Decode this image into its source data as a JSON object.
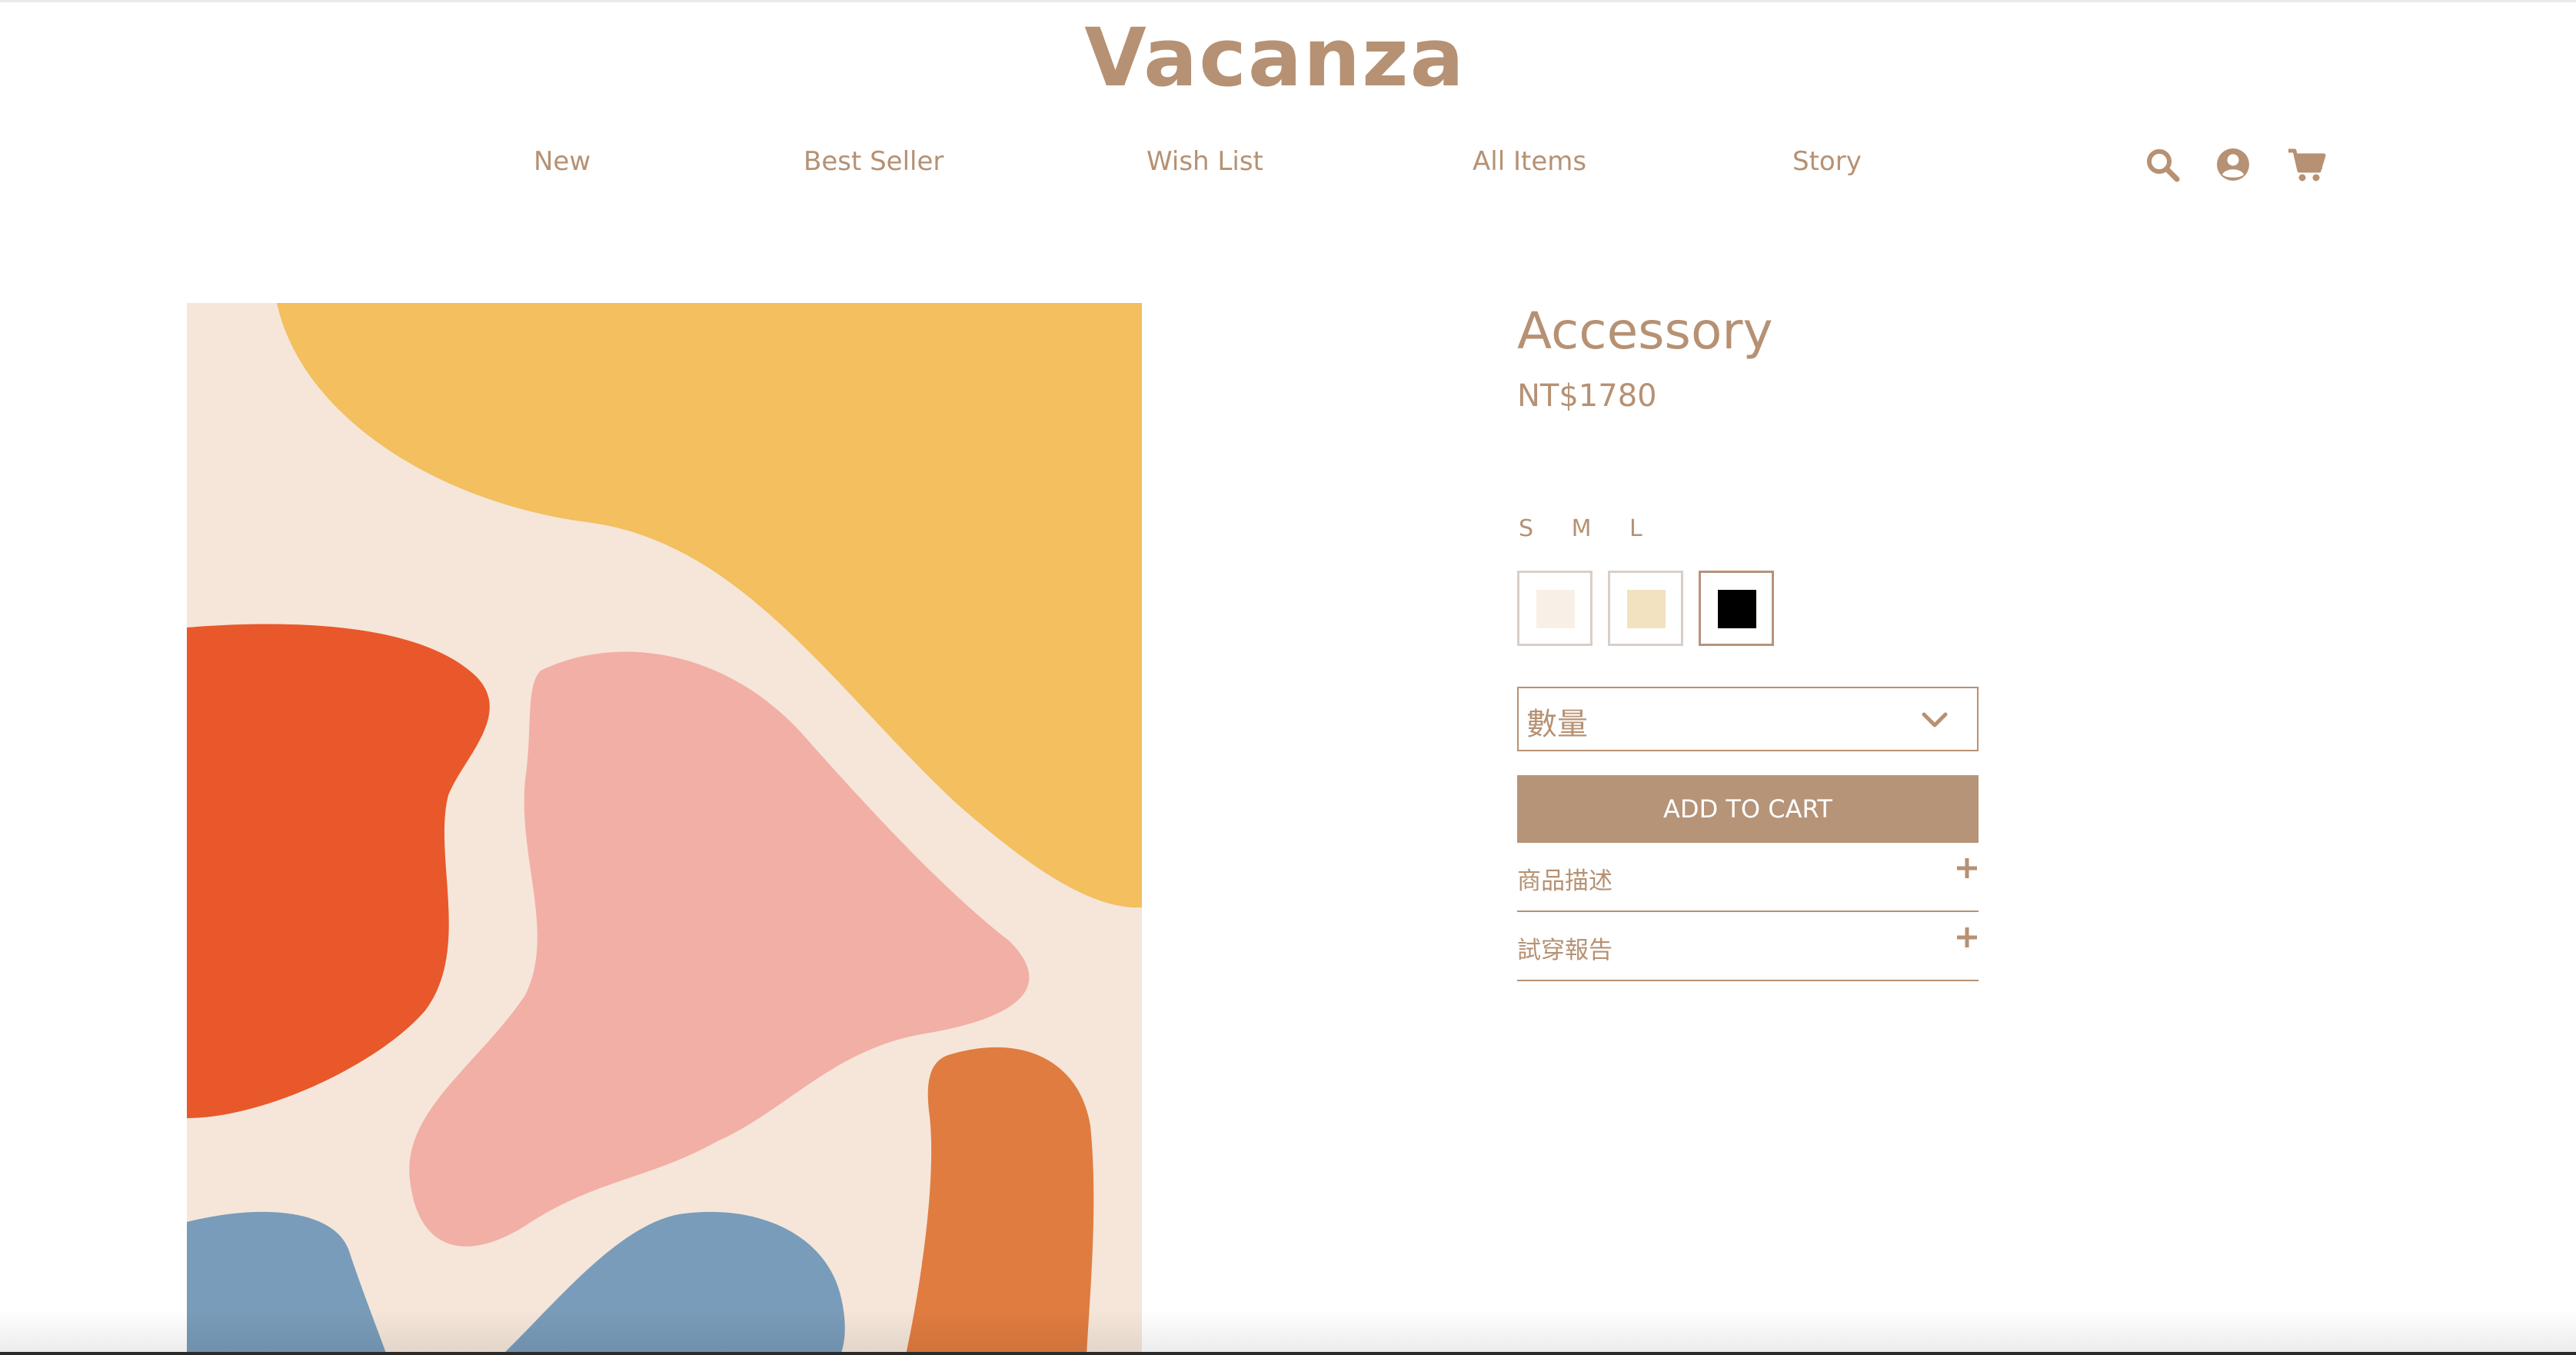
{
  "brand": {
    "logo": "Vacanza",
    "color": "#b69173"
  },
  "nav": {
    "items": [
      "New",
      "Best Seller",
      "Wish List",
      "All Items",
      "Story"
    ],
    "icons": [
      "search-icon",
      "user-icon",
      "cart-icon"
    ]
  },
  "product": {
    "title": "Accessory",
    "price": "NT$1780",
    "sizes_label": "S M L",
    "colors": [
      {
        "name": "cream",
        "hex": "#f8f0e6",
        "selected": false
      },
      {
        "name": "beige",
        "hex": "#f3e2bf",
        "selected": false
      },
      {
        "name": "black",
        "hex": "#000000",
        "selected": true
      }
    ],
    "quantity_placeholder": "數量",
    "add_to_cart": "ADD TO CART",
    "accordions": [
      "商品描述",
      "試穿報告"
    ]
  },
  "colors": {
    "accent": "#b69173",
    "button": "#b69478",
    "art_background": "#f5e6d9",
    "art_yellow": "#f3bf5f",
    "art_red": "#e8582a",
    "art_pink": "#f2afa6",
    "art_blue": "#799cba",
    "art_orange": "#e07c40"
  }
}
